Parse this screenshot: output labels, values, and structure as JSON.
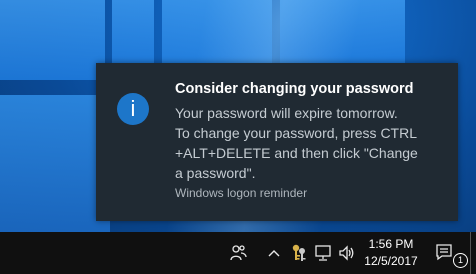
{
  "notification": {
    "icon": "info-icon",
    "icon_glyph": "i",
    "icon_color": "#1d76c9",
    "title": "Consider changing your password",
    "body_lines": [
      "Your password will expire tomorrow.",
      "To change your password, press CTRL",
      "+ALT+DELETE and then click \"Change",
      "a password\"."
    ],
    "source": "Windows logon reminder"
  },
  "taskbar": {
    "tray_icons": [
      "people-icon",
      "chevron-up-icon",
      "keys-icon",
      "network-icon",
      "volume-icon"
    ],
    "clock": {
      "time": "1:56 PM",
      "date": "12/5/2017"
    },
    "action_center": {
      "icon": "action-center-icon",
      "badge_count": "1"
    }
  }
}
